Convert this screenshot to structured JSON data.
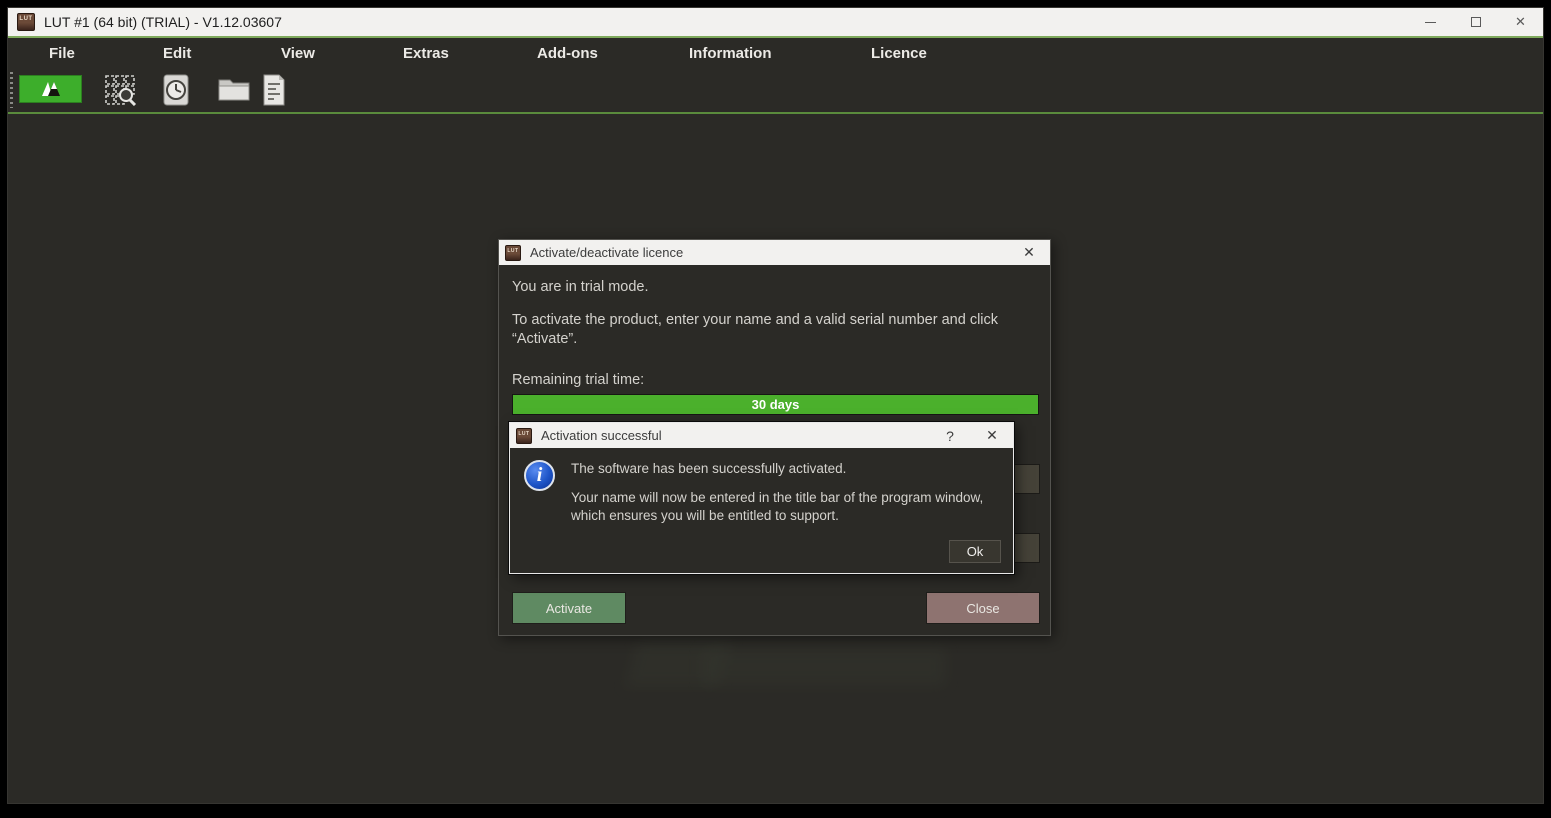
{
  "window": {
    "title": "LUT #1 (64 bit) (TRIAL) - V1.12.03607",
    "app_icon_text": "LUT",
    "close_glyph": "✕"
  },
  "menubar": {
    "items": [
      "File",
      "Edit",
      "View",
      "Extras",
      "Add-ons",
      "Information",
      "Licence"
    ]
  },
  "toolbar": {
    "icons": [
      "logo-toggle",
      "grid-search",
      "history",
      "open-folder",
      "document"
    ],
    "accent_green": "#3dae2b"
  },
  "licence_dialog": {
    "title": "Activate/deactivate licence",
    "close_glyph": "✕",
    "trial_mode_text": "You are in trial mode.",
    "instructions": "To activate the product, enter your name and a valid serial number and click “Activate”.",
    "remaining_label": "Remaining trial time:",
    "trial_progress": {
      "label": "30 days",
      "percent": 100,
      "bar_color": "#4bb02c"
    },
    "activate_label": "Activate",
    "close_label": "Close",
    "activate_color": "#5f8a62",
    "close_color": "#8e7370"
  },
  "activation_dialog": {
    "title": "Activation successful",
    "help_glyph": "?",
    "close_glyph": "✕",
    "message_primary": "The software has been successfully activated.",
    "message_secondary": "Your name will now be entered in the title bar of the program window, which ensures you will be entitled to support.",
    "ok_label": "Ok"
  }
}
